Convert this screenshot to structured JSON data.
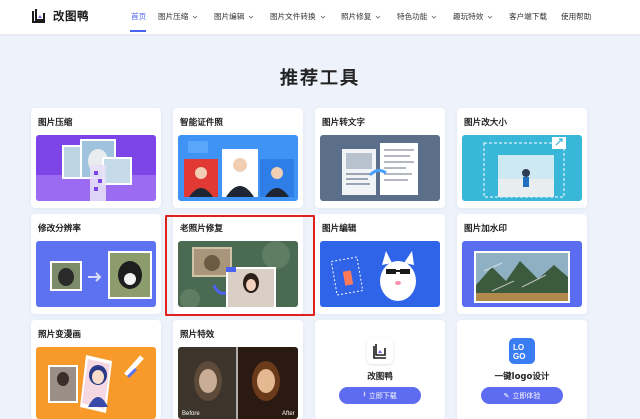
{
  "header": {
    "brand": "改图鸭",
    "nav": [
      {
        "label": "首页",
        "active": true,
        "has_caret": false
      },
      {
        "label": "图片压缩",
        "has_caret": true
      },
      {
        "label": "图片编辑",
        "has_caret": true
      },
      {
        "label": "图片文件转换",
        "has_caret": true
      },
      {
        "label": "照片修复",
        "has_caret": true
      },
      {
        "label": "特色功能",
        "has_caret": true
      },
      {
        "label": "趣玩特效",
        "has_caret": true
      },
      {
        "label": "客户端下载",
        "has_caret": false
      },
      {
        "label": "使用帮助",
        "has_caret": false
      }
    ]
  },
  "main": {
    "title": "推荐工具",
    "cards": [
      {
        "label": "图片压缩"
      },
      {
        "label": "智能证件照"
      },
      {
        "label": "图片转文字"
      },
      {
        "label": "图片改大小"
      },
      {
        "label": "修改分辨率"
      },
      {
        "label": "老照片修复"
      },
      {
        "label": "图片编辑"
      },
      {
        "label": "图片加水印"
      },
      {
        "label": "照片变漫画"
      },
      {
        "label": "照片特效",
        "before": "Before",
        "after": "After"
      }
    ],
    "promos": [
      {
        "title": "改图鸭",
        "button": "立即下载"
      },
      {
        "title": "一键logo设计",
        "button": "立即体验"
      }
    ]
  },
  "colors": {
    "accent": "#4a63f2",
    "highlight": "#e0211d"
  }
}
